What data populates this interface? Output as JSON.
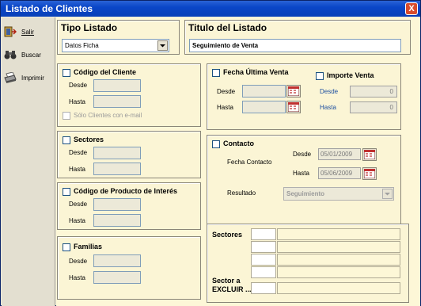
{
  "window": {
    "title": "Listado de Clientes",
    "close_label": "X"
  },
  "sidebar": {
    "items": [
      {
        "label": "Salir",
        "icon": "exit-icon"
      },
      {
        "label": "Buscar",
        "icon": "binoculars-icon"
      },
      {
        "label": "Imprimir",
        "icon": "printer-icon"
      }
    ]
  },
  "tipo_listado": {
    "heading": "Tipo Listado",
    "selected": "Datos Ficha"
  },
  "titulo_listado": {
    "heading": "Titulo del Listado",
    "value": "Seguimiento de Venta"
  },
  "codigo_cliente": {
    "label": "Código del Cliente",
    "desde": "Desde",
    "hasta": "Hasta",
    "email_only": "Sólo Clientes con e-mail"
  },
  "sectores": {
    "label": "Sectores",
    "desde": "Desde",
    "hasta": "Hasta"
  },
  "codigo_producto": {
    "label": "Código de Producto de Interés",
    "desde": "Desde",
    "hasta": "Hasta"
  },
  "familias": {
    "label": "Familias",
    "desde": "Desde",
    "hasta": "Hasta"
  },
  "fecha_ultima_venta": {
    "label": "Fecha Última Venta",
    "desde": "Desde",
    "hasta": "Hasta"
  },
  "importe_venta": {
    "label": "Importe Venta",
    "desde": "Desde",
    "hasta": "Hasta",
    "desde_value": "0",
    "hasta_value": "0"
  },
  "contacto": {
    "label": "Contacto",
    "fecha_contacto": "Fecha Contacto",
    "desde": "Desde",
    "hasta": "Hasta",
    "desde_value": "05/01/2009",
    "hasta_value": "05/06/2009",
    "resultado": "Resultado",
    "resultado_value": "Seguimiento"
  },
  "sectores_excluir": {
    "label": "Sectores",
    "excluir_line1": "Sector a",
    "excluir_line2": "EXCLUIR ..."
  },
  "colors": {
    "title_bar": "#0a46c8",
    "panel_bg": "#fbf5d5",
    "accent_text": "#1c4fa0"
  }
}
